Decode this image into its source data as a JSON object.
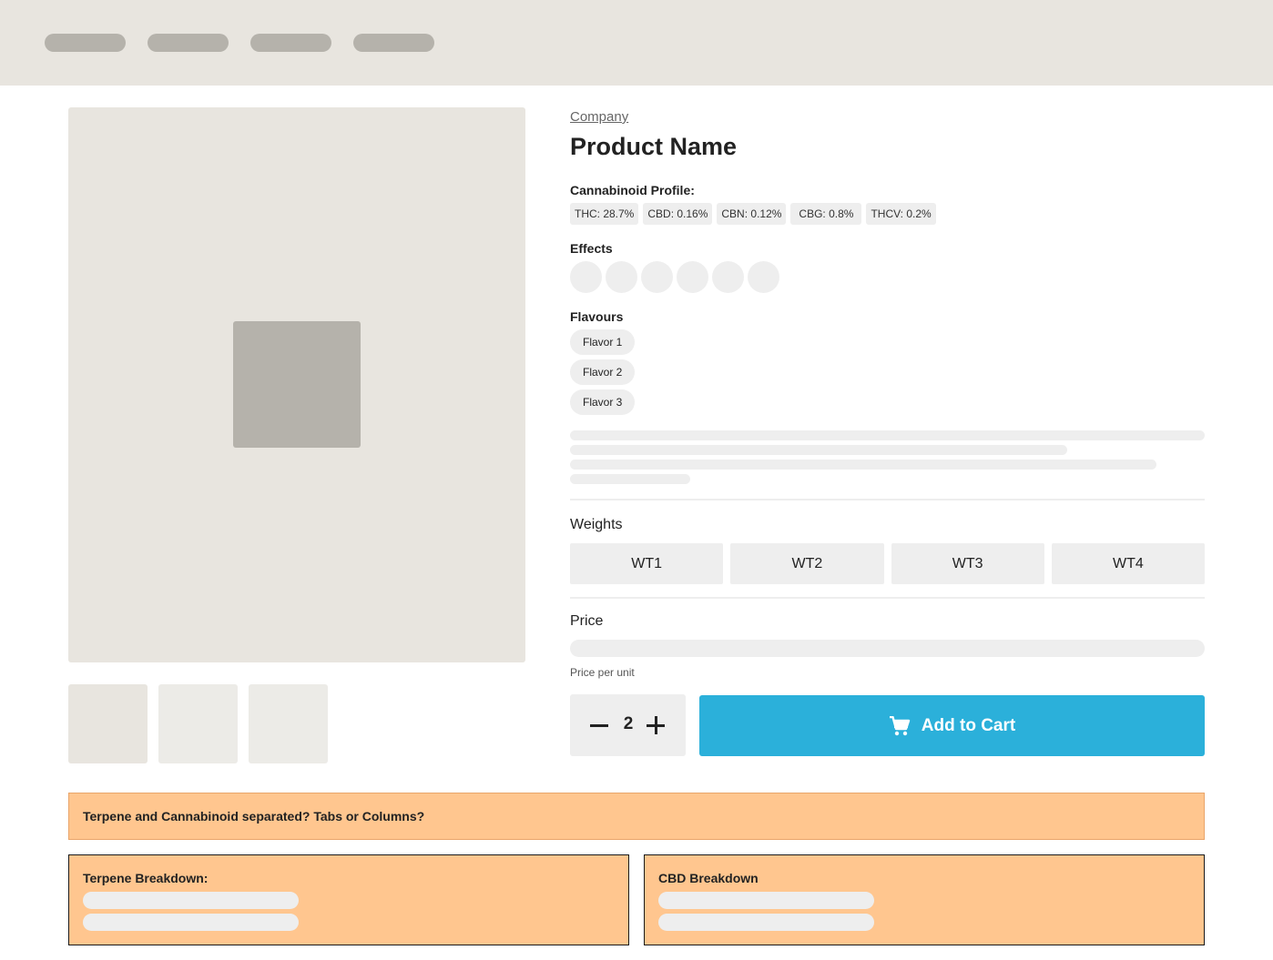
{
  "header": {
    "nav_items": [
      "nav-item-1",
      "nav-item-2",
      "nav-item-3",
      "nav-item-4"
    ]
  },
  "product": {
    "company": "Company",
    "name": "Product Name",
    "cannabinoid_label": "Cannabinoid Profile:",
    "cannabinoids": [
      "THC: 28.7%",
      "CBD: 0.16%",
      "CBN: 0.12%",
      "CBG: 0.8%",
      "THCV: 0.2%"
    ],
    "effects_label": "Effects",
    "flavours_label": "Flavours",
    "flavours": [
      "Flavor 1",
      "Flavor 2",
      "Flavor 3"
    ],
    "weights_label": "Weights",
    "weights": [
      "WT1",
      "WT2",
      "WT3",
      "WT4"
    ],
    "price_label": "Price",
    "price_per_unit": "Price per unit",
    "quantity": "2",
    "add_to_cart": "Add to Cart"
  },
  "notes": {
    "banner": "Terpene and Cannabinoid separated? Tabs or Columns?",
    "terpene_title": "Terpene Breakdown:",
    "cbd_title": "CBD Breakdown"
  },
  "colors": {
    "accent": "#2bb0da",
    "placeholder": "#e8e5df",
    "annotation": "#ffc68f"
  }
}
